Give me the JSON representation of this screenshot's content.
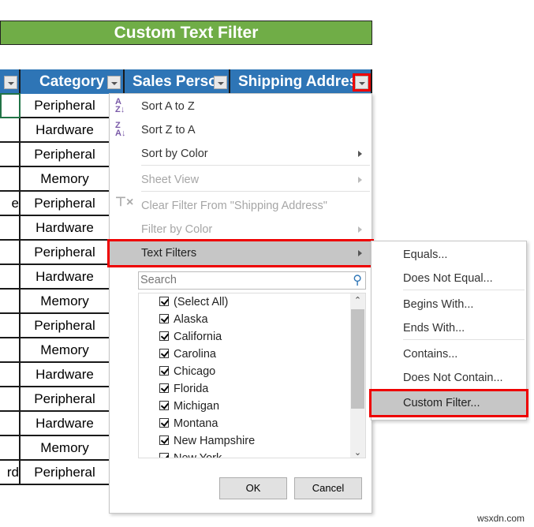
{
  "title": "Custom Text Filter",
  "headers": {
    "category": "Category",
    "sales_person": "Sales Perso",
    "shipping": "Shipping Addres"
  },
  "col_a": {
    "r5": "e",
    "r16": "rd"
  },
  "categories": [
    "Peripheral",
    "Hardware",
    "Peripheral",
    "Memory",
    "Peripheral",
    "Hardware",
    "Peripheral",
    "Hardware",
    "Memory",
    "Peripheral",
    "Memory",
    "Hardware",
    "Peripheral",
    "Hardware",
    "Memory",
    "Peripheral"
  ],
  "menu": {
    "sort_az": "Sort A to Z",
    "sort_za": "Sort Z to A",
    "sort_color": "Sort by Color",
    "sheet_view": "Sheet View",
    "clear_filter": "Clear Filter From \"Shipping Address\"",
    "filter_color": "Filter by Color",
    "text_filters": "Text Filters",
    "search_placeholder": "Search",
    "ok": "OK",
    "cancel": "Cancel"
  },
  "list_items": [
    "(Select All)",
    "Alaska",
    "California",
    "Carolina",
    "Chicago",
    "Florida",
    "Michigan",
    "Montana",
    "New Hampshire",
    "New York"
  ],
  "submenu": [
    "Equals...",
    "Does Not Equal...",
    "Begins With...",
    "Ends With...",
    "Contains...",
    "Does Not Contain...",
    "Custom Filter..."
  ],
  "watermark": "wsxdn.com",
  "colors": {
    "title_bg": "#70ad47",
    "header_bg": "#2e75b6",
    "highlight": "#ee0000"
  }
}
